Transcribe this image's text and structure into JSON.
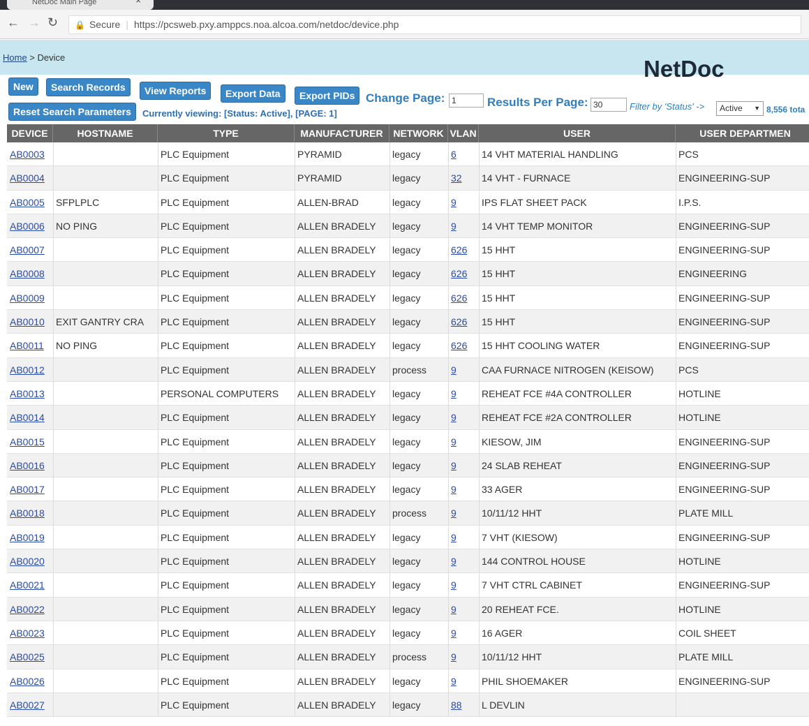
{
  "browser": {
    "tab_title": "NetDoc Main Page",
    "secure_label": "Secure",
    "url": "https://pcsweb.pxy.amppcs.noa.alcoa.com/netdoc/device.php"
  },
  "header": {
    "breadcrumb_home": "Home",
    "breadcrumb_sep": ">",
    "breadcrumb_current": "Device",
    "title": "NetDoc"
  },
  "toolbar": {
    "new_label": "New",
    "search_label": "Search Records",
    "reports_label": "View Reports",
    "export_label": "Export Data",
    "export_pids_label": "Export PIDs",
    "reset_label": "Reset Search Parameters",
    "change_page_label": "Change Page:",
    "page_value": "1",
    "results_per_page_label": "Results Per Page:",
    "results_per_page_value": "30",
    "filter_label": "Filter by 'Status' ->",
    "status_selected": "Active",
    "total_text": "8,556 tota",
    "viewing_text": "Currently viewing: [Status: Active], [PAGE: 1]"
  },
  "table": {
    "columns": [
      "DEVICE",
      "HOSTNAME",
      "TYPE",
      "MANUFACTURER",
      "NETWORK",
      "VLAN",
      "USER",
      "USER DEPARTMEN"
    ],
    "rows": [
      {
        "device": "AB0003",
        "hostname": "",
        "type": "PLC Equipment",
        "manufacturer": "PYRAMID",
        "network": "legacy",
        "vlan": "6",
        "user": "14 VHT MATERIAL HANDLING",
        "dept": "PCS"
      },
      {
        "device": "AB0004",
        "hostname": "",
        "type": "PLC Equipment",
        "manufacturer": "PYRAMID",
        "network": "legacy",
        "vlan": "32",
        "user": "14 VHT - FURNACE",
        "dept": "ENGINEERING-SUP"
      },
      {
        "device": "AB0005",
        "hostname": "SFPLPLC",
        "type": "PLC Equipment",
        "manufacturer": "ALLEN-BRAD",
        "network": "legacy",
        "vlan": "9",
        "user": "IPS FLAT SHEET PACK",
        "dept": "I.P.S."
      },
      {
        "device": "AB0006",
        "hostname": "NO PING",
        "type": "PLC Equipment",
        "manufacturer": "ALLEN BRADELY",
        "network": "legacy",
        "vlan": "9",
        "user": "14 VHT TEMP MONITOR",
        "dept": "ENGINEERING-SUP"
      },
      {
        "device": "AB0007",
        "hostname": "",
        "type": "PLC Equipment",
        "manufacturer": "ALLEN BRADELY",
        "network": "legacy",
        "vlan": "626",
        "user": "15 HHT",
        "dept": "ENGINEERING-SUP"
      },
      {
        "device": "AB0008",
        "hostname": "",
        "type": "PLC Equipment",
        "manufacturer": "ALLEN BRADELY",
        "network": "legacy",
        "vlan": "626",
        "user": "15 HHT",
        "dept": "ENGINEERING"
      },
      {
        "device": "AB0009",
        "hostname": "",
        "type": "PLC Equipment",
        "manufacturer": "ALLEN BRADELY",
        "network": "legacy",
        "vlan": "626",
        "user": "15 HHT",
        "dept": "ENGINEERING-SUP"
      },
      {
        "device": "AB0010",
        "hostname": "EXIT GANTRY CRA",
        "type": "PLC Equipment",
        "manufacturer": "ALLEN BRADELY",
        "network": "legacy",
        "vlan": "626",
        "user": "15 HHT",
        "dept": "ENGINEERING-SUP"
      },
      {
        "device": "AB0011",
        "hostname": "NO PING",
        "type": "PLC Equipment",
        "manufacturer": "ALLEN BRADELY",
        "network": "legacy",
        "vlan": "626",
        "user": "15 HHT COOLING WATER",
        "dept": "ENGINEERING-SUP"
      },
      {
        "device": "AB0012",
        "hostname": "",
        "type": "PLC Equipment",
        "manufacturer": "ALLEN BRADELY",
        "network": "process",
        "vlan": "9",
        "user": "CAA FURNACE NITROGEN (KEISOW)",
        "dept": "PCS"
      },
      {
        "device": "AB0013",
        "hostname": "",
        "type": "PERSONAL COMPUTERS",
        "manufacturer": "ALLEN BRADELY",
        "network": "legacy",
        "vlan": "9",
        "user": "REHEAT FCE #4A CONTROLLER",
        "dept": "HOTLINE"
      },
      {
        "device": "AB0014",
        "hostname": "",
        "type": "PLC Equipment",
        "manufacturer": "ALLEN BRADELY",
        "network": "legacy",
        "vlan": "9",
        "user": "REHEAT FCE #2A CONTROLLER",
        "dept": "HOTLINE"
      },
      {
        "device": "AB0015",
        "hostname": "",
        "type": "PLC Equipment",
        "manufacturer": "ALLEN BRADELY",
        "network": "legacy",
        "vlan": "9",
        "user": "KIESOW, JIM",
        "dept": "ENGINEERING-SUP"
      },
      {
        "device": "AB0016",
        "hostname": "",
        "type": "PLC Equipment",
        "manufacturer": "ALLEN BRADELY",
        "network": "legacy",
        "vlan": "9",
        "user": "24 SLAB REHEAT",
        "dept": "ENGINEERING-SUP"
      },
      {
        "device": "AB0017",
        "hostname": "",
        "type": "PLC Equipment",
        "manufacturer": "ALLEN BRADELY",
        "network": "legacy",
        "vlan": "9",
        "user": "33 AGER",
        "dept": "ENGINEERING-SUP"
      },
      {
        "device": "AB0018",
        "hostname": "",
        "type": "PLC Equipment",
        "manufacturer": "ALLEN BRADELY",
        "network": "process",
        "vlan": "9",
        "user": "10/11/12 HHT",
        "dept": "PLATE MILL"
      },
      {
        "device": "AB0019",
        "hostname": "",
        "type": "PLC Equipment",
        "manufacturer": "ALLEN BRADELY",
        "network": "legacy",
        "vlan": "9",
        "user": "7 VHT (KIESOW)",
        "dept": "ENGINEERING-SUP"
      },
      {
        "device": "AB0020",
        "hostname": "",
        "type": "PLC Equipment",
        "manufacturer": "ALLEN BRADELY",
        "network": "legacy",
        "vlan": "9",
        "user": "144 CONTROL HOUSE",
        "dept": "HOTLINE"
      },
      {
        "device": "AB0021",
        "hostname": "",
        "type": "PLC Equipment",
        "manufacturer": "ALLEN BRADELY",
        "network": "legacy",
        "vlan": "9",
        "user": "7 VHT CTRL CABINET",
        "dept": "ENGINEERING-SUP"
      },
      {
        "device": "AB0022",
        "hostname": "",
        "type": "PLC Equipment",
        "manufacturer": "ALLEN BRADELY",
        "network": "legacy",
        "vlan": "9",
        "user": "20 REHEAT FCE.",
        "dept": "HOTLINE"
      },
      {
        "device": "AB0023",
        "hostname": "",
        "type": "PLC Equipment",
        "manufacturer": "ALLEN BRADELY",
        "network": "legacy",
        "vlan": "9",
        "user": "16 AGER",
        "dept": "COIL SHEET"
      },
      {
        "device": "AB0025",
        "hostname": "",
        "type": "PLC Equipment",
        "manufacturer": "ALLEN BRADELY",
        "network": "process",
        "vlan": "9",
        "user": "10/11/12 HHT",
        "dept": "PLATE MILL"
      },
      {
        "device": "AB0026",
        "hostname": "",
        "type": "PLC Equipment",
        "manufacturer": "ALLEN BRADELY",
        "network": "legacy",
        "vlan": "9",
        "user": "PHIL SHOEMAKER",
        "dept": "ENGINEERING-SUP"
      },
      {
        "device": "AB0027",
        "hostname": "",
        "type": "PLC Equipment",
        "manufacturer": "ALLEN BRADELY",
        "network": "legacy",
        "vlan": "88",
        "user": "L DEVLIN",
        "dept": ""
      }
    ]
  },
  "colors": {
    "header_band": "#c7e6ef",
    "button_bg": "#3a87c8",
    "label_blue": "#2f7fc0",
    "table_header": "#666666",
    "link": "#2a4aa8"
  },
  "icons": [
    "lock-icon",
    "back-arrow-icon",
    "forward-arrow-icon",
    "reload-icon",
    "dropdown-chevron-icon",
    "tab-close-icon"
  ]
}
